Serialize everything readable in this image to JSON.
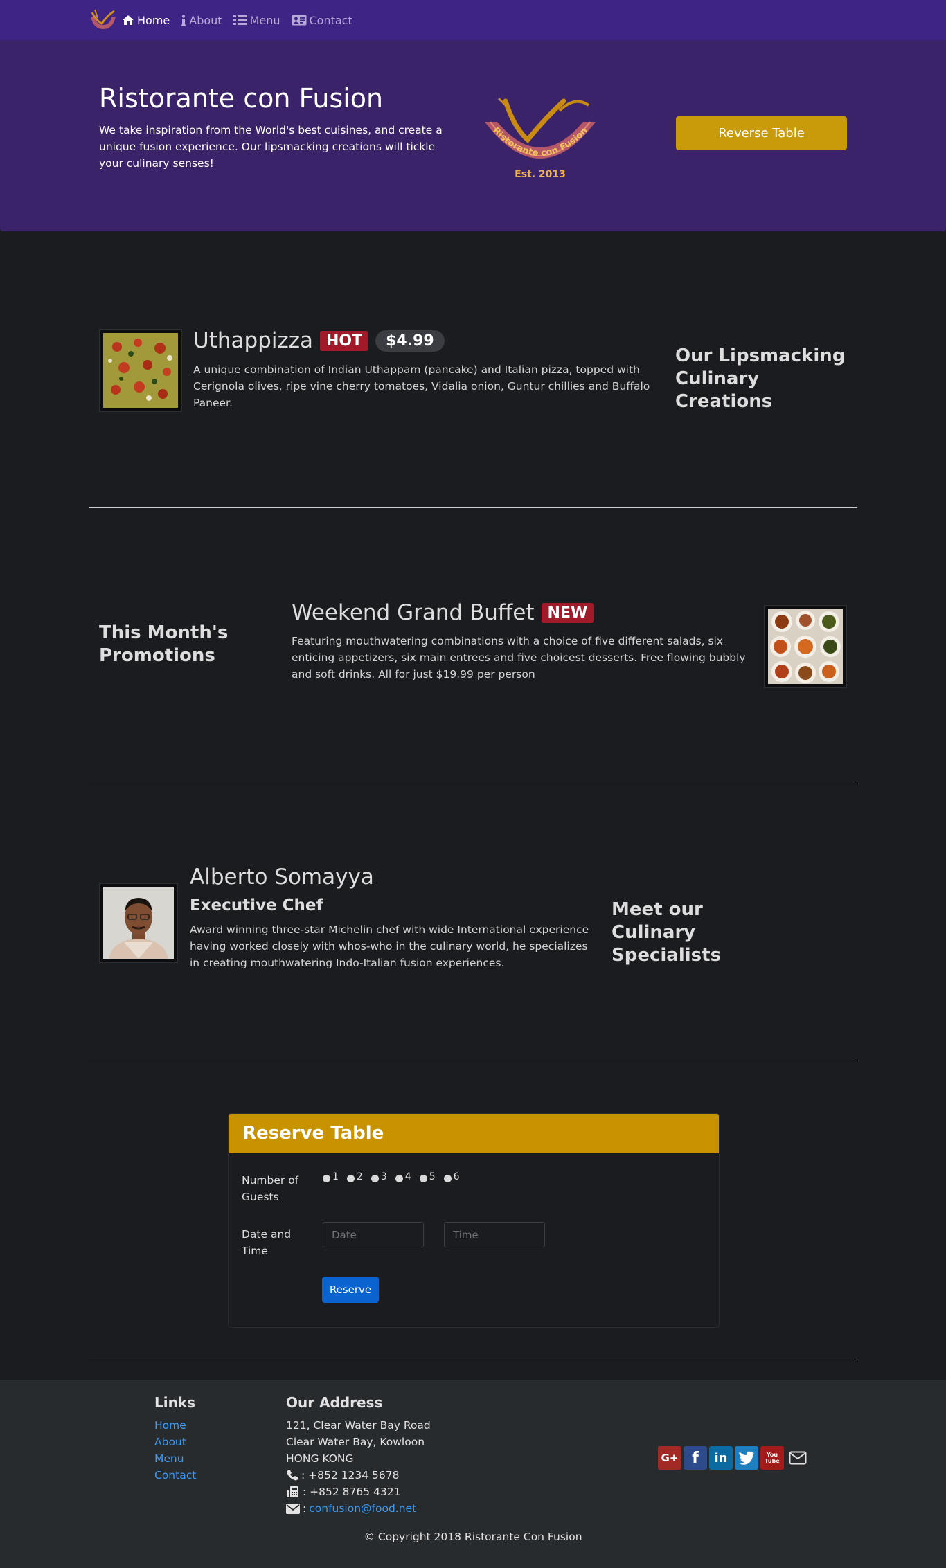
{
  "nav": {
    "items": [
      {
        "label": "Home",
        "icon": "home-icon",
        "active": true
      },
      {
        "label": "About",
        "icon": "info-icon",
        "active": false
      },
      {
        "label": "Menu",
        "icon": "list-icon",
        "active": false
      },
      {
        "label": "Contact",
        "icon": "address-card-icon",
        "active": false
      }
    ]
  },
  "jumbotron": {
    "title": "Ristorante con Fusion",
    "text": "We take inspiration from the World's best cuisines, and create a unique fusion experience. Our lipsmacking creations will tickle your culinary senses!",
    "logo_text": "Ristorante con Fusion",
    "logo_est": "Est. 2013",
    "reserve_label": "Reverse Table"
  },
  "dish": {
    "section_title": "Our Lipsmacking Culinary Creations",
    "name": "Uthappizza",
    "badge": "HOT",
    "price": "$4.99",
    "description": "A unique combination of Indian Uthappam (pancake) and Italian pizza, topped with Cerignola olives, ripe vine cherry tomatoes, Vidalia onion, Guntur chillies and Buffalo Paneer."
  },
  "promotion": {
    "section_title": "This Month's Promotions",
    "name": "Weekend Grand Buffet",
    "badge": "NEW",
    "description": "Featuring mouthwatering combinations with a choice of five different salads, six enticing appetizers, six main entrees and five choicest desserts. Free flowing bubbly and soft drinks. All for just $19.99 per person"
  },
  "leader": {
    "section_title": "Meet our Culinary Specialists",
    "name": "Alberto Somayya",
    "designation": "Executive Chef",
    "description": "Award winning three-star Michelin chef with wide International experience having worked closely with whos-who in the culinary world, he specializes in creating mouthwatering Indo-Italian fusion experiences."
  },
  "reserve": {
    "title": "Reserve Table",
    "guests_label": "Number of Guests",
    "guest_options": [
      "1",
      "2",
      "3",
      "4",
      "5",
      "6"
    ],
    "datetime_label": "Date and Time",
    "date_placeholder": "Date",
    "time_placeholder": "Time",
    "submit_label": "Reserve"
  },
  "footer": {
    "links_title": "Links",
    "links": [
      "Home",
      "About",
      "Menu",
      "Contact"
    ],
    "address_title": "Our Address",
    "address_lines": [
      "121, Clear Water Bay Road",
      "Clear Water Bay, Kowloon",
      "HONG KONG"
    ],
    "phone": ": +852 1234 5678",
    "fax": ": +852 8765 4321",
    "email_prefix": ":",
    "email": "confusion@food.net",
    "social": [
      {
        "icon": "google-plus-icon",
        "text": "G+",
        "color": "#a32a24"
      },
      {
        "icon": "facebook-icon",
        "text": "f",
        "color": "#2d4a8a"
      },
      {
        "icon": "linkedin-icon",
        "text": "in",
        "color": "#0b6aa0"
      },
      {
        "icon": "twitter-icon",
        "text": "",
        "color": "#1d7fbf"
      },
      {
        "icon": "youtube-icon",
        "text": "You Tube",
        "color": "#a31a1a"
      },
      {
        "icon": "mail-icon",
        "text": "",
        "color": "transparent"
      }
    ],
    "copyright": "© Copyright 2018 Ristorante Con Fusion"
  },
  "colors": {
    "navbar": "#3d2485",
    "jumbotron": "#3a2368",
    "accent_gold": "#c99a0a",
    "badge_red": "#a11a2a",
    "primary_blue": "#0a63cf",
    "link_blue": "#3b9af5"
  }
}
